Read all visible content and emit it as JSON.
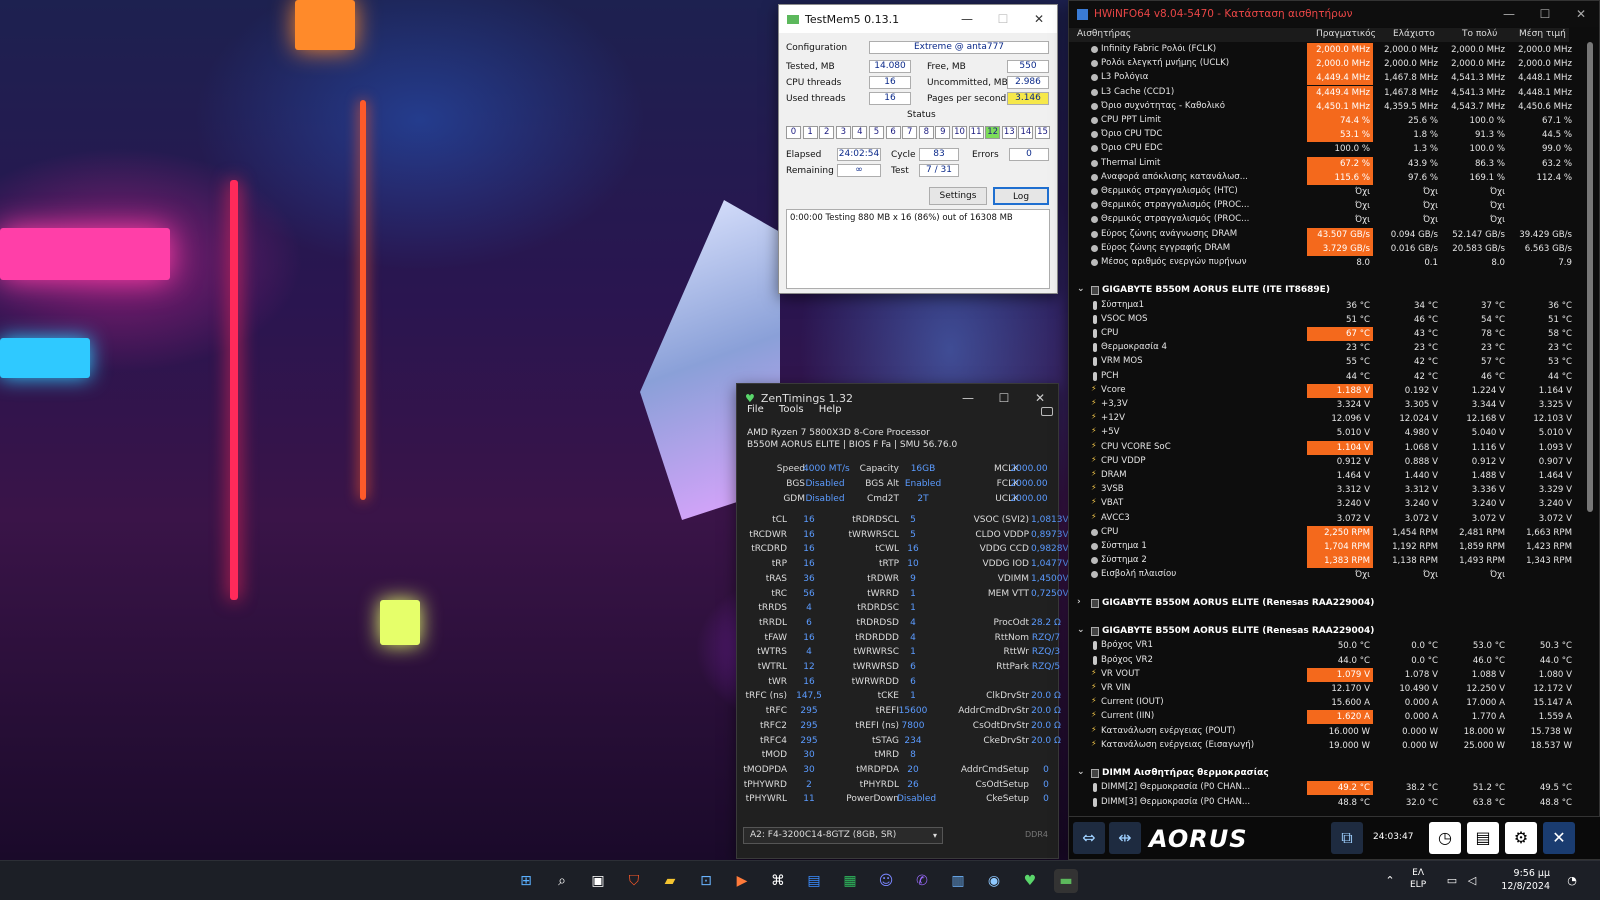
{
  "testmem": {
    "title": "TestMem5  0.13.1",
    "config_label": "Configuration",
    "config": "Extreme @ anta777",
    "tested_label": "Tested, MB",
    "tested": "14.080",
    "free_label": "Free, MB",
    "free": "550",
    "threads_label": "CPU threads",
    "threads": "16",
    "uncommitted_label": "Uncommitted, MB",
    "uncommitted": "2.986",
    "used_label": "Used threads",
    "used": "16",
    "pps_label": "Pages per second",
    "pps": "3.146",
    "status_label": "Status",
    "cells": [
      "0",
      "1",
      "2",
      "3",
      "4",
      "5",
      "6",
      "7",
      "8",
      "9",
      "10",
      "11",
      "12",
      "13",
      "14",
      "15"
    ],
    "elapsed_label": "Elapsed",
    "elapsed": "24:02:54",
    "cycle_label": "Cycle",
    "cycle": "83",
    "errors_label": "Errors",
    "errors": "0",
    "remaining_label": "Remaining",
    "remaining": "∞",
    "test_label": "Test",
    "test": "7 / 31",
    "settings": "Settings",
    "log": "Log",
    "log_text": "0:00:00  Testing 880 MB x 16 (86%) out of 16308 MB"
  },
  "zen": {
    "title": "ZenTimings 1.32",
    "menu": [
      "File",
      "Tools",
      "Help"
    ],
    "cpu": "AMD Ryzen 7 5800X3D 8-Core Processor",
    "board": "B550M AORUS ELITE | BIOS F Fa | SMU 56.76.0",
    "top": [
      [
        "Speed",
        "4000 MT/s",
        "Capacity",
        "16GB",
        "MCLK",
        "2000.00"
      ],
      [
        "BGS",
        "Disabled",
        "BGS Alt",
        "Enabled",
        "FCLK",
        "2000.00"
      ],
      [
        "GDM",
        "Disabled",
        "Cmd2T",
        "2T",
        "UCLK",
        "2000.00"
      ]
    ],
    "rows": [
      [
        "tCL",
        "16",
        "tRDRDSCL",
        "5",
        "VSOC (SVI2)",
        "1,0813V"
      ],
      [
        "tRCDWR",
        "16",
        "tWRWRSCL",
        "5",
        "CLDO VDDP",
        "0,8973V"
      ],
      [
        "tRCDRD",
        "16",
        "tCWL",
        "16",
        "VDDG CCD",
        "0,9828V"
      ],
      [
        "tRP",
        "16",
        "tRTP",
        "10",
        "VDDG IOD",
        "1,0477V"
      ],
      [
        "tRAS",
        "36",
        "tRDWR",
        "9",
        "VDIMM",
        "1,4500V"
      ],
      [
        "tRC",
        "56",
        "tWRRD",
        "1",
        "MEM VTT",
        "0,7250V"
      ],
      [
        "tRRDS",
        "4",
        "tRDRDSC",
        "1",
        "",
        ""
      ],
      [
        "tRRDL",
        "6",
        "tRDRDSD",
        "4",
        "ProcOdt",
        "28.2 Ω"
      ],
      [
        "tFAW",
        "16",
        "tRDRDDD",
        "4",
        "RttNom",
        "RZQ/7"
      ],
      [
        "tWTRS",
        "4",
        "tWRWRSC",
        "1",
        "RttWr",
        "RZQ/3"
      ],
      [
        "tWTRL",
        "12",
        "tWRWRSD",
        "6",
        "RttPark",
        "RZQ/5"
      ],
      [
        "tWR",
        "16",
        "tWRWRDD",
        "6",
        "",
        ""
      ],
      [
        "tRFC (ns)",
        "147,5",
        "tCKE",
        "1",
        "ClkDrvStr",
        "20.0 Ω"
      ],
      [
        "tRFC",
        "295",
        "tREFI",
        "15600",
        "AddrCmdDrvStr",
        "20.0 Ω"
      ],
      [
        "tRFC2",
        "295",
        "tREFI (ns)",
        "7800",
        "CsOdtDrvStr",
        "20.0 Ω"
      ],
      [
        "tRFC4",
        "295",
        "tSTAG",
        "234",
        "CkeDrvStr",
        "20.0 Ω"
      ],
      [
        "tMOD",
        "30",
        "tMRD",
        "8",
        "",
        ""
      ],
      [
        "tMODPDA",
        "30",
        "tMRDPDA",
        "20",
        "AddrCmdSetup",
        "0"
      ],
      [
        "tPHYWRD",
        "2",
        "tPHYRDL",
        "26",
        "CsOdtSetup",
        "0"
      ],
      [
        "tPHYWRL",
        "11",
        "PowerDown",
        "Disabled",
        "CkeSetup",
        "0"
      ]
    ],
    "dimm": "A2: F4-3200C14-8GTZ (8GB, SR)",
    "ddr": "DDR4"
  },
  "hwinfo": {
    "title": "HWiNFO64 v8.04-5470 - Κατάσταση αισθητήρων",
    "cols": [
      "Αισθητήρας",
      "Πραγματικός",
      "Ελάχιστο",
      "Το πολύ",
      "Μέση τιμή"
    ],
    "clock": "24:03:47",
    "logo": "AORUS",
    "rows": [
      {
        "k": "r",
        "ic": "o",
        "n": "Infinity Fabric Ρολόι (FCLK)",
        "v": [
          "2,000.0 MHz",
          "2,000.0 MHz",
          "2,000.0 MHz",
          "2,000.0 MHz"
        ],
        "h": 1
      },
      {
        "k": "r",
        "ic": "o",
        "n": "Ρολόι ελεγκτή μνήμης (UCLK)",
        "v": [
          "2,000.0 MHz",
          "2,000.0 MHz",
          "2,000.0 MHz",
          "2,000.0 MHz"
        ],
        "h": 1
      },
      {
        "k": "r",
        "ic": "o",
        "n": "L3 Ρολόγια",
        "v": [
          "4,449.4 MHz",
          "1,467.8 MHz",
          "4,541.3 MHz",
          "4,448.1 MHz"
        ],
        "h": 1
      },
      {
        "k": "r",
        "ic": "o",
        "n": "L3 Cache (CCD1)",
        "v": [
          "4,449.4 MHz",
          "1,467.8 MHz",
          "4,541.3 MHz",
          "4,448.1 MHz"
        ],
        "h": 1
      },
      {
        "k": "r",
        "ic": "o",
        "n": "Όριο συχνότητας - Καθολικό",
        "v": [
          "4,450.1 MHz",
          "4,359.5 MHz",
          "4,543.7 MHz",
          "4,450.6 MHz"
        ],
        "h": 1
      },
      {
        "k": "r",
        "ic": "o",
        "n": "CPU PPT Limit",
        "v": [
          "74.4 %",
          "25.6 %",
          "100.0 %",
          "67.1 %"
        ],
        "h": 1
      },
      {
        "k": "r",
        "ic": "o",
        "n": "Όριο CPU TDC",
        "v": [
          "53.1 %",
          "1.8 %",
          "91.3 %",
          "44.5 %"
        ],
        "h": 1
      },
      {
        "k": "r",
        "ic": "o",
        "n": "Όριο CPU EDC",
        "v": [
          "100.0 %",
          "1.3 %",
          "100.0 %",
          "99.0 %"
        ],
        "h": 0
      },
      {
        "k": "r",
        "ic": "o",
        "n": "Thermal Limit",
        "v": [
          "67.2 %",
          "43.9 %",
          "86.3 %",
          "63.2 %"
        ],
        "h": 1
      },
      {
        "k": "r",
        "ic": "o",
        "n": "Αναφορά απόκλισης κατανάλωσ...",
        "v": [
          "115.6 %",
          "97.6 %",
          "169.1 %",
          "112.4 %"
        ],
        "h": 1
      },
      {
        "k": "r",
        "ic": "o",
        "n": "Θερμικός στραγγαλισμός (HTC)",
        "v": [
          "Όχι",
          "Όχι",
          "Όχι",
          ""
        ],
        "h": 0
      },
      {
        "k": "r",
        "ic": "o",
        "n": "Θερμικός στραγγαλισμός (PROC...",
        "v": [
          "Όχι",
          "Όχι",
          "Όχι",
          ""
        ],
        "h": 0
      },
      {
        "k": "r",
        "ic": "o",
        "n": "Θερμικός στραγγαλισμός (PROC...",
        "v": [
          "Όχι",
          "Όχι",
          "Όχι",
          ""
        ],
        "h": 0
      },
      {
        "k": "r",
        "ic": "o",
        "n": "Εύρος ζώνης ανάγνωσης DRAM",
        "v": [
          "43.507 GB/s",
          "0.094 GB/s",
          "52.147 GB/s",
          "39.429 GB/s"
        ],
        "h": 1
      },
      {
        "k": "r",
        "ic": "o",
        "n": "Εύρος ζώνης εγγραφής DRAM",
        "v": [
          "3.729 GB/s",
          "0.016 GB/s",
          "20.583 GB/s",
          "6.563 GB/s"
        ],
        "h": 1
      },
      {
        "k": "r",
        "ic": "o",
        "n": "Μέσος αριθμός ενεργών πυρήνων",
        "v": [
          "8.0",
          "0.1",
          "8.0",
          "7.9"
        ],
        "h": 0
      },
      {
        "k": "s"
      },
      {
        "k": "g",
        "n": "GIGABYTE B550M AORUS ELITE (ITE IT8689E)",
        "ar": "⌄"
      },
      {
        "k": "r",
        "ic": "t",
        "n": "Σύστημα1",
        "v": [
          "36 °C",
          "34 °C",
          "37 °C",
          "36 °C"
        ],
        "h": 0
      },
      {
        "k": "r",
        "ic": "t",
        "n": "VSOC MOS",
        "v": [
          "51 °C",
          "46 °C",
          "54 °C",
          "51 °C"
        ],
        "h": 0
      },
      {
        "k": "r",
        "ic": "t",
        "n": "CPU",
        "v": [
          "67 °C",
          "43 °C",
          "78 °C",
          "58 °C"
        ],
        "h": 1
      },
      {
        "k": "r",
        "ic": "t",
        "n": "Θερμοκρασία 4",
        "v": [
          "23 °C",
          "23 °C",
          "23 °C",
          "23 °C"
        ],
        "h": 0
      },
      {
        "k": "r",
        "ic": "t",
        "n": "VRM MOS",
        "v": [
          "55 °C",
          "42 °C",
          "57 °C",
          "53 °C"
        ],
        "h": 0
      },
      {
        "k": "r",
        "ic": "t",
        "n": "PCH",
        "v": [
          "44 °C",
          "42 °C",
          "46 °C",
          "44 °C"
        ],
        "h": 0
      },
      {
        "k": "r",
        "ic": "v",
        "n": "Vcore",
        "v": [
          "1.188 V",
          "0.192 V",
          "1.224 V",
          "1.164 V"
        ],
        "h": 1
      },
      {
        "k": "r",
        "ic": "v",
        "n": "+3,3V",
        "v": [
          "3.324 V",
          "3.305 V",
          "3.344 V",
          "3.325 V"
        ],
        "h": 0
      },
      {
        "k": "r",
        "ic": "v",
        "n": "+12V",
        "v": [
          "12.096 V",
          "12.024 V",
          "12.168 V",
          "12.103 V"
        ],
        "h": 0
      },
      {
        "k": "r",
        "ic": "v",
        "n": "+5V",
        "v": [
          "5.010 V",
          "4.980 V",
          "5.040 V",
          "5.010 V"
        ],
        "h": 0
      },
      {
        "k": "r",
        "ic": "v",
        "n": "CPU VCORE SoC",
        "v": [
          "1.104 V",
          "1.068 V",
          "1.116 V",
          "1.093 V"
        ],
        "h": 1
      },
      {
        "k": "r",
        "ic": "v",
        "n": "CPU VDDP",
        "v": [
          "0.912 V",
          "0.888 V",
          "0.912 V",
          "0.907 V"
        ],
        "h": 0
      },
      {
        "k": "r",
        "ic": "v",
        "n": "DRAM",
        "v": [
          "1.464 V",
          "1.440 V",
          "1.488 V",
          "1.464 V"
        ],
        "h": 0
      },
      {
        "k": "r",
        "ic": "v",
        "n": "3VSB",
        "v": [
          "3.312 V",
          "3.312 V",
          "3.336 V",
          "3.329 V"
        ],
        "h": 0
      },
      {
        "k": "r",
        "ic": "v",
        "n": "VBAT",
        "v": [
          "3.240 V",
          "3.240 V",
          "3.240 V",
          "3.240 V"
        ],
        "h": 0
      },
      {
        "k": "r",
        "ic": "v",
        "n": "AVCC3",
        "v": [
          "3.072 V",
          "3.072 V",
          "3.072 V",
          "3.072 V"
        ],
        "h": 0
      },
      {
        "k": "r",
        "ic": "o",
        "n": "CPU",
        "v": [
          "2,250 RPM",
          "1,454 RPM",
          "2,481 RPM",
          "1,663 RPM"
        ],
        "h": 1
      },
      {
        "k": "r",
        "ic": "o",
        "n": "Σύστημα 1",
        "v": [
          "1,704 RPM",
          "1,192 RPM",
          "1,859 RPM",
          "1,423 RPM"
        ],
        "h": 1
      },
      {
        "k": "r",
        "ic": "o",
        "n": "Σύστημα 2",
        "v": [
          "1,383 RPM",
          "1,138 RPM",
          "1,493 RPM",
          "1,343 RPM"
        ],
        "h": 1
      },
      {
        "k": "r",
        "ic": "o",
        "n": "Εισβολή πλαισίου",
        "v": [
          "Όχι",
          "Όχι",
          "Όχι",
          ""
        ],
        "h": 0
      },
      {
        "k": "s"
      },
      {
        "k": "g",
        "n": "GIGABYTE B550M AORUS ELITE (Renesas RAA229004)",
        "ar": "›"
      },
      {
        "k": "s"
      },
      {
        "k": "g",
        "n": "GIGABYTE B550M AORUS ELITE (Renesas RAA229004)",
        "ar": "⌄"
      },
      {
        "k": "r",
        "ic": "t",
        "n": "Βρόχος VR1",
        "v": [
          "50.0 °C",
          "0.0 °C",
          "53.0 °C",
          "50.3 °C"
        ],
        "h": 0
      },
      {
        "k": "r",
        "ic": "t",
        "n": "Βρόχος VR2",
        "v": [
          "44.0 °C",
          "0.0 °C",
          "46.0 °C",
          "44.0 °C"
        ],
        "h": 0
      },
      {
        "k": "r",
        "ic": "v",
        "n": "VR VOUT",
        "v": [
          "1.079 V",
          "1.078 V",
          "1.088 V",
          "1.080 V"
        ],
        "h": 1
      },
      {
        "k": "r",
        "ic": "v",
        "n": "VR VIN",
        "v": [
          "12.170 V",
          "10.490 V",
          "12.250 V",
          "12.172 V"
        ],
        "h": 0
      },
      {
        "k": "r",
        "ic": "v",
        "n": "Current (IOUT)",
        "v": [
          "15.600 A",
          "0.000 A",
          "17.000 A",
          "15.147 A"
        ],
        "h": 0
      },
      {
        "k": "r",
        "ic": "v",
        "n": "Current (IIN)",
        "v": [
          "1.620 A",
          "0.000 A",
          "1.770 A",
          "1.559 A"
        ],
        "h": 1
      },
      {
        "k": "r",
        "ic": "v",
        "n": "Κατανάλωση ενέργειας (POUT)",
        "v": [
          "16.000 W",
          "0.000 W",
          "18.000 W",
          "15.738 W"
        ],
        "h": 0
      },
      {
        "k": "r",
        "ic": "v",
        "n": "Κατανάλωση ενέργειας (Εισαγωγή)",
        "v": [
          "19.000 W",
          "0.000 W",
          "25.000 W",
          "18.537 W"
        ],
        "h": 0
      },
      {
        "k": "s"
      },
      {
        "k": "g",
        "n": "DIMM Αισθητήρας θερμοκρασίας",
        "ar": "⌄"
      },
      {
        "k": "r",
        "ic": "t",
        "n": "DIMM[2] Θερμοκρασία (P0 CHAN...",
        "v": [
          "49.2 °C",
          "38.2 °C",
          "51.2 °C",
          "49.5 °C"
        ],
        "h": 1
      },
      {
        "k": "r",
        "ic": "t",
        "n": "DIMM[3] Θερμοκρασία (P0 CHAN...",
        "v": [
          "48.8 °C",
          "32.0 °C",
          "63.8 °C",
          "48.8 °C"
        ],
        "h": 0
      }
    ]
  },
  "taskbar": {
    "lang1": "ΕΛ",
    "lang2": "ELP",
    "time": "9:56 μμ",
    "date": "12/8/2024"
  },
  "colors": {
    "highlight": "#f4691c",
    "accent": "#e94646",
    "zen_value": "#5b9bff",
    "active_cell": "#7ddc5a"
  }
}
